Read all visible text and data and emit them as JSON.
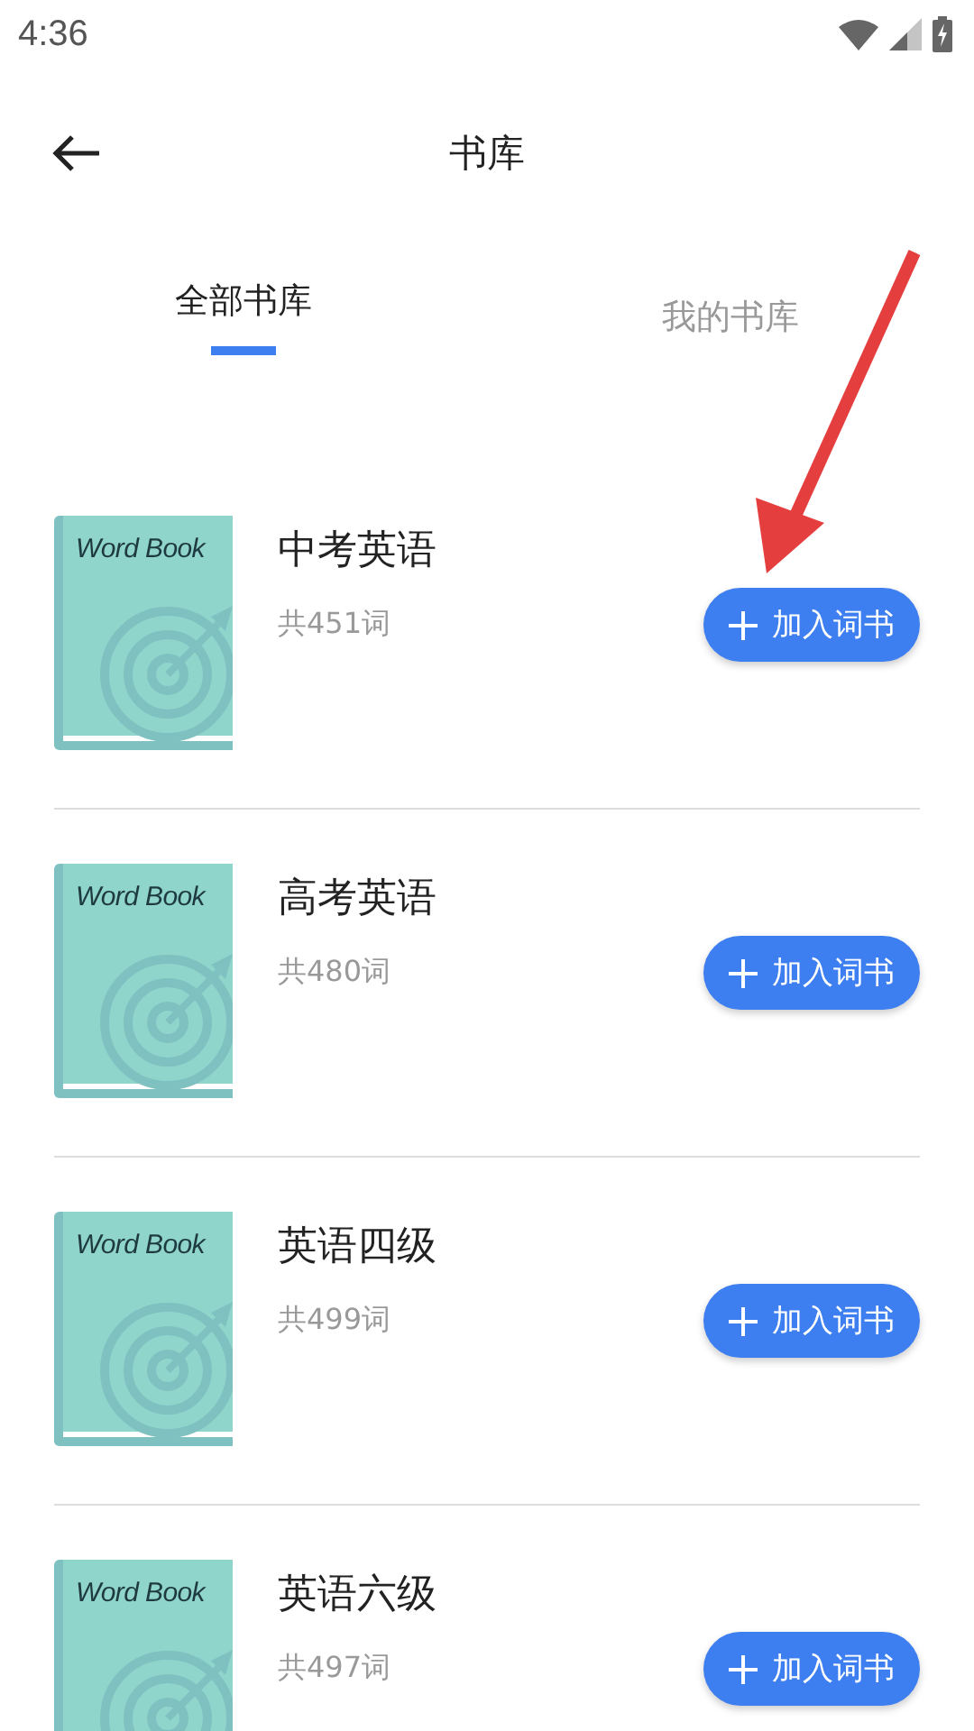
{
  "status_bar": {
    "time": "4:36"
  },
  "header": {
    "title": "书库"
  },
  "tabs": [
    {
      "label": "全部书库",
      "selected": true
    },
    {
      "label": "我的书库",
      "selected": false
    }
  ],
  "books": [
    {
      "cover_text": "Word Book",
      "title": "中考英语",
      "count": "共451词",
      "button": "加入词书"
    },
    {
      "cover_text": "Word Book",
      "title": "高考英语",
      "count": "共480词",
      "button": "加入词书"
    },
    {
      "cover_text": "Word Book",
      "title": "英语四级",
      "count": "共499词",
      "button": "加入词书"
    },
    {
      "cover_text": "Word Book",
      "title": "英语六级",
      "count": "共497词",
      "button": "加入词书"
    }
  ]
}
